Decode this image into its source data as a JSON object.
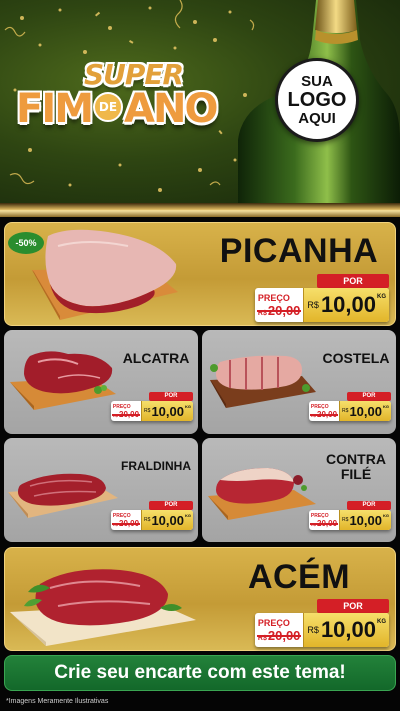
{
  "header": {
    "title_super": "SUPER",
    "title_fim": "FIM",
    "title_de": "DE",
    "title_ano": "ANO",
    "logo_line1": "SUA",
    "logo_line2": "LOGO",
    "logo_line3": "AQUI"
  },
  "colors": {
    "header_green": "#2e4512",
    "gold": "#c49b36",
    "grey_card": "#a4a4a4",
    "price_red": "#d41f26",
    "price_yellow": "#e2b52a",
    "cta_green": "#13682a"
  },
  "products": {
    "picanha": {
      "name": "PICANHA",
      "discount": "-50%",
      "por": "POR",
      "preco_label": "PREÇO",
      "old_prefix": "R$",
      "old_price": "20,00",
      "currency": "R$",
      "price": "10,00",
      "unit": "KG"
    },
    "alcatra": {
      "name": "ALCATRA",
      "por": "POR",
      "preco_label": "PREÇO",
      "old_prefix": "R$",
      "old_price": "20,00",
      "currency": "R$",
      "price": "10,00",
      "unit": "KG"
    },
    "costela": {
      "name": "COSTELA",
      "por": "POR",
      "preco_label": "PREÇO",
      "old_prefix": "R$",
      "old_price": "20,00",
      "currency": "R$",
      "price": "10,00",
      "unit": "KG"
    },
    "fraldinha": {
      "name": "FRALDINHA",
      "por": "POR",
      "preco_label": "PREÇO",
      "old_prefix": "R$",
      "old_price": "20,00",
      "currency": "R$",
      "price": "10,00",
      "unit": "KG"
    },
    "contra_file": {
      "name_line1": "CONTRA",
      "name_line2": "FILÉ",
      "por": "POR",
      "preco_label": "PREÇO",
      "old_prefix": "R$",
      "old_price": "20,00",
      "currency": "R$",
      "price": "10,00",
      "unit": "KG"
    },
    "acem": {
      "name": "ACÉM",
      "por": "POR",
      "preco_label": "PREÇO",
      "old_prefix": "R$",
      "old_price": "20,00",
      "currency": "R$",
      "price": "10,00",
      "unit": "KG"
    }
  },
  "footer": {
    "cta": "Crie seu encarte com este tema!",
    "disclaimer": "*Imagens Meramente Ilustrativas"
  }
}
